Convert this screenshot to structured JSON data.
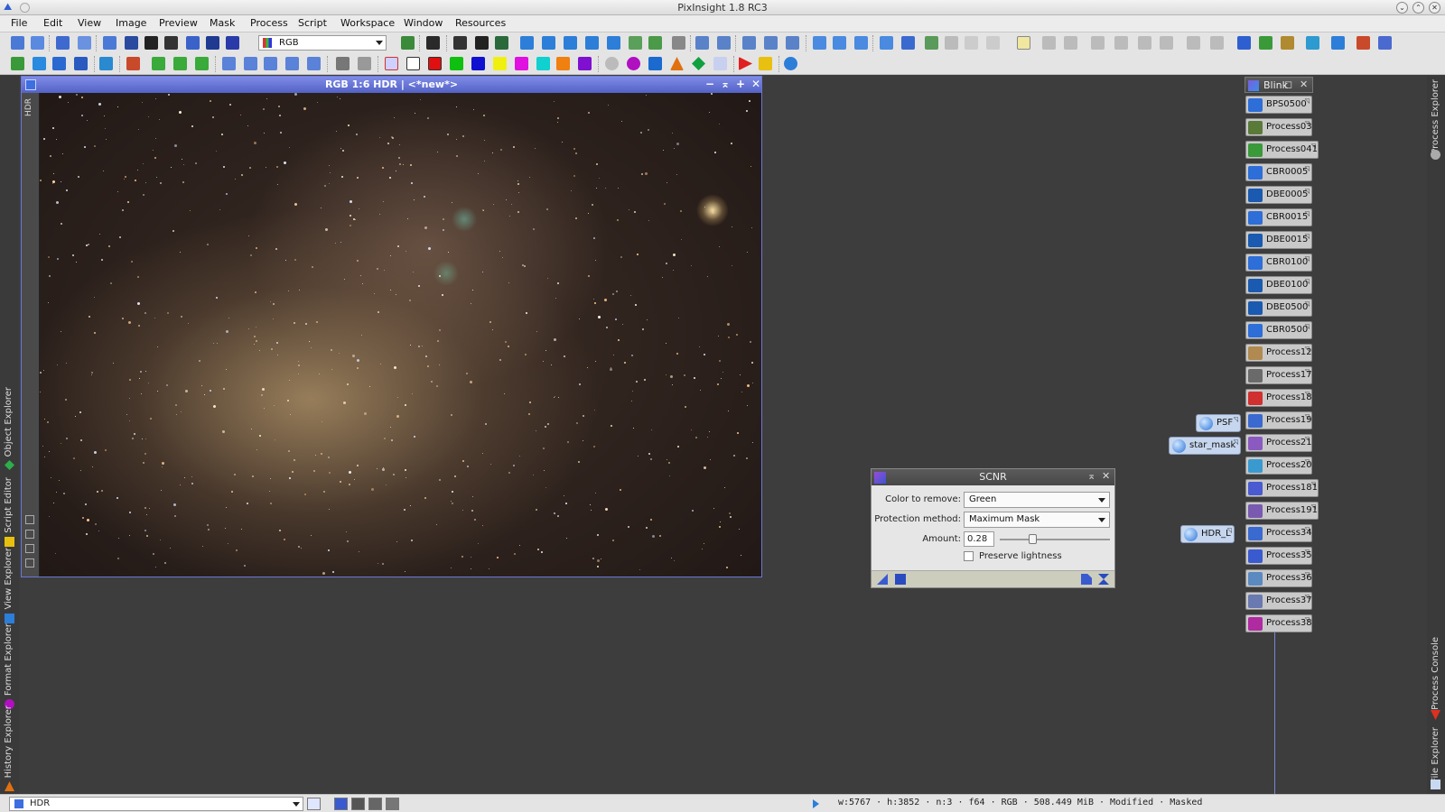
{
  "app": {
    "title": "PixInsight 1.8 RC3"
  },
  "menu": [
    "File",
    "Edit",
    "View",
    "Image",
    "Preview",
    "Mask",
    "Process",
    "Script",
    "Workspace",
    "Window",
    "Resources"
  ],
  "toolbar": {
    "color_space": "RGB"
  },
  "left_tabs": [
    "Object Explorer",
    "Script Editor",
    "View Explorer",
    "Format Explorer",
    "History Explorer"
  ],
  "right_tabs": [
    "Process Explorer",
    "Process Console",
    "File Explorer"
  ],
  "image_window": {
    "title": "RGB 1:6 HDR | <*new*>",
    "side_label": "HDR"
  },
  "blink": {
    "title": "Blink"
  },
  "icons": [
    "BPS0500",
    "Process03",
    "Process041",
    "CBR0005",
    "DBE0005",
    "CBR0015",
    "DBE0015",
    "CBR0100",
    "DBE0100",
    "DBE0500",
    "CBR0500",
    "Process12",
    "Process17",
    "Process18",
    "Process19",
    "Process21",
    "Process20",
    "Process181",
    "Process191",
    "Process34",
    "Process35",
    "Process36",
    "Process37",
    "Process38"
  ],
  "process_icons": {
    "psf": "PSF",
    "star_mask": "star_mask",
    "hdr": "HDR_L"
  },
  "scnr": {
    "title": "SCNR",
    "color_label": "Color to remove:",
    "color_value": "Green",
    "protection_label": "Protection method:",
    "protection_value": "Maximum Mask",
    "amount_label": "Amount:",
    "amount_value": "0.28",
    "amount_level": 0.28,
    "preserve_label": "Preserve lightness",
    "preserve_checked": false
  },
  "status": {
    "view": "HDR",
    "text": "w:5767 · h:3852 · n:3 · f64 · RGB · 508.449 MiB · Modified · Masked"
  }
}
